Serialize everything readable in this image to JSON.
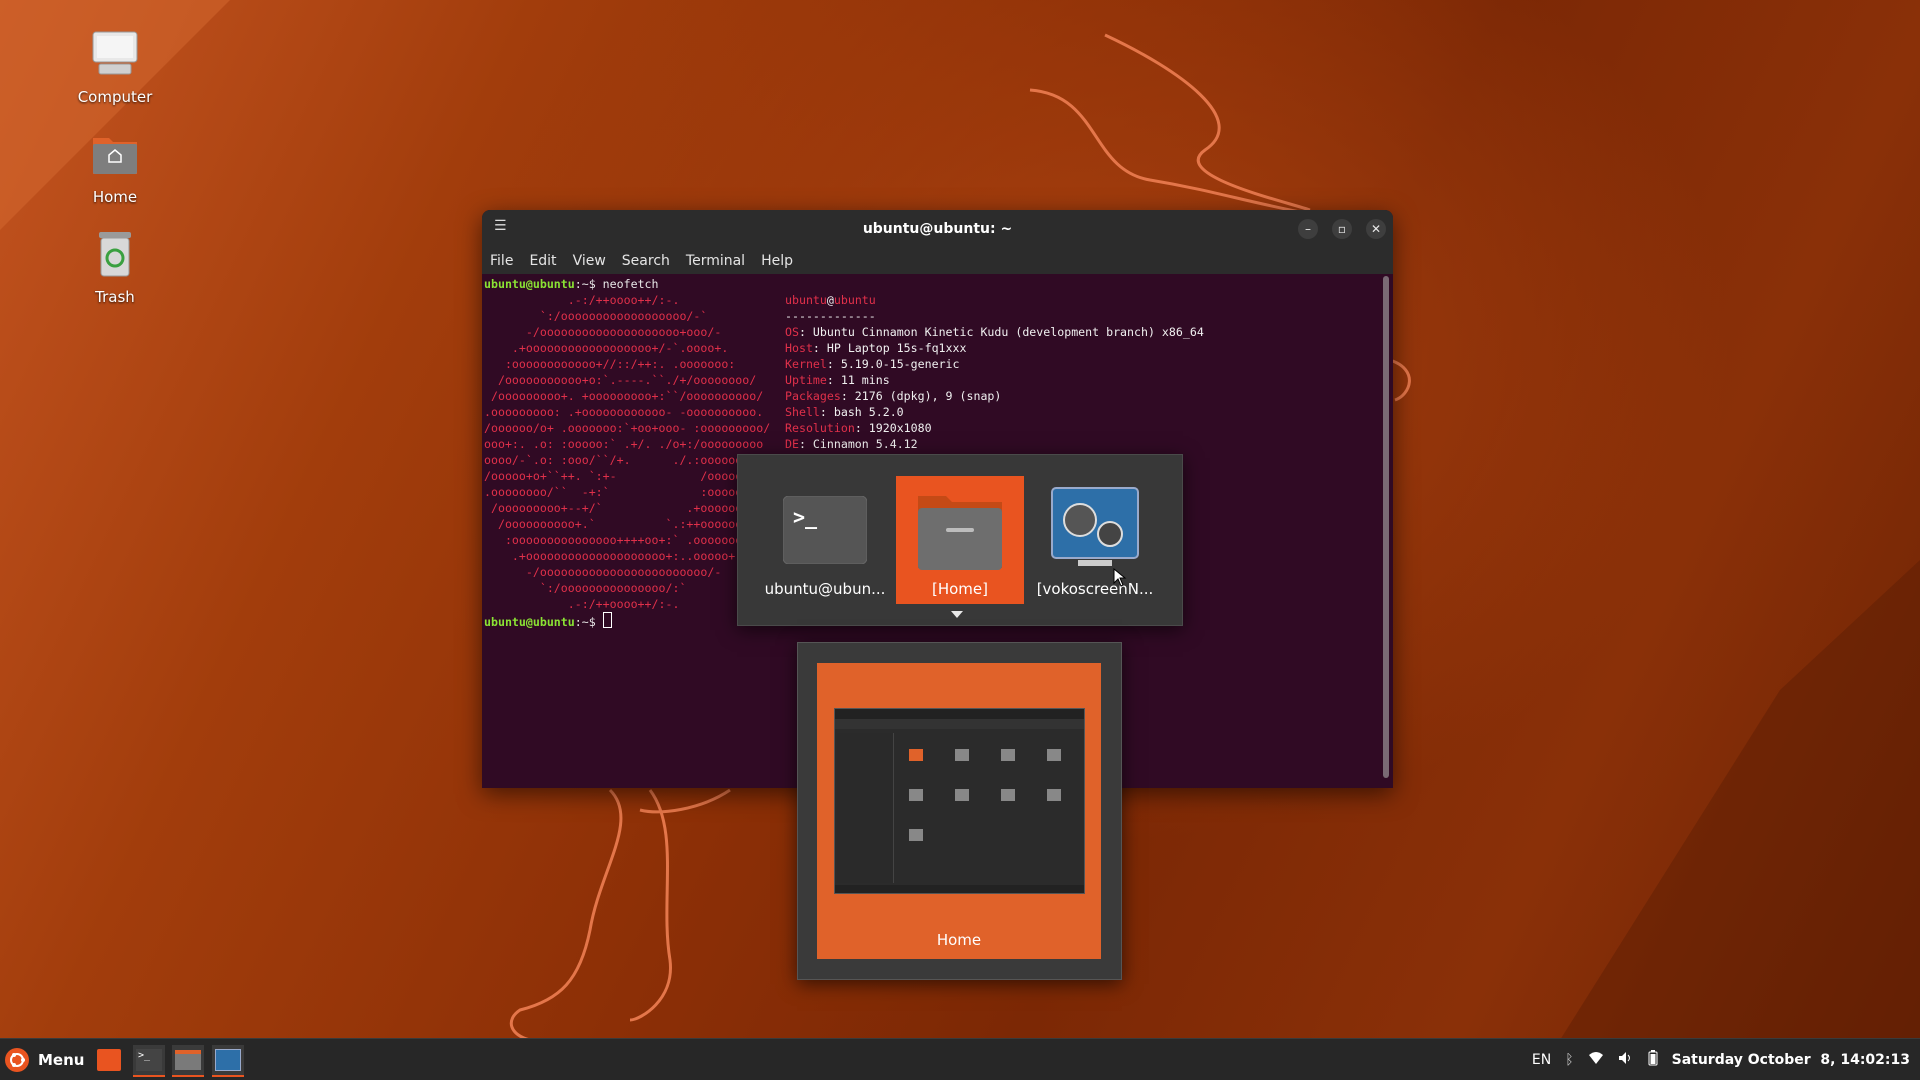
{
  "desktop": {
    "icons": [
      {
        "label": "Computer",
        "icon": "computer-icon"
      },
      {
        "label": "Home",
        "icon": "home-folder-icon"
      },
      {
        "label": "Trash",
        "icon": "trash-icon"
      }
    ]
  },
  "terminal": {
    "title": "ubuntu@ubuntu: ~",
    "menu": [
      "File",
      "Edit",
      "View",
      "Search",
      "Terminal",
      "Help"
    ],
    "prompt": "ubuntu@ubuntu",
    "prompt_suffix": ":~$ ",
    "command": "neofetch",
    "art_lines": [
      "            .-:/++oooo++/:-.",
      "        `:/oooooooooooooooooo/-`",
      "      -/oooooooooooooooooooo+ooo/-",
      "    .+oooooooooooooooooo+/-`.oooo+.",
      "   :oooooooooooo+//::/++:. .ooooooo:",
      "  /ooooooooooo+o:`.----.``./+/oooooooo/",
      " /ooooooooo+. +ooooooooo+:``/oooooooooo/",
      ".ooooooooo: .+oooooooooooo- -oooooooooo.",
      "/oooooo/o+ .ooooooo:`+oo+ooo- :ooooooooo/",
      "ooo+:. .o: :ooooo:` .+/. ./o+:/ooooooooo",
      "oooo/-`.o: :ooo/``/+.      ./.:ooooooo",
      "/ooooo+o+``++. `:+-            /ooooo",
      ".oooooooo/``  -+:`             :ooooo",
      " /ooooooooo+--+/`            .+ooooooo",
      "  /oooooooooo+.`          `.:++ooooooo",
      "   :ooooooooooooooo++++oo+:` .ooooooo",
      "    .+oooooooooooooooooooo+:..ooooo+.",
      "      -/oooooooooooooooooooooooo/-",
      "        `:/ooooooooooooooo/:`",
      "            .-:/++oooo++/:-."
    ],
    "info_header": {
      "user": "ubuntu",
      "at": "@",
      "host": "ubuntu",
      "separator": "-------------"
    },
    "info": [
      {
        "key": "OS",
        "value": ": Ubuntu Cinnamon Kinetic Kudu (development branch) x86_64"
      },
      {
        "key": "Host",
        "value": ": HP Laptop 15s-fq1xxx"
      },
      {
        "key": "Kernel",
        "value": ": 5.19.0-15-generic"
      },
      {
        "key": "Uptime",
        "value": ": 11 mins"
      },
      {
        "key": "Packages",
        "value": ": 2176 (dpkg), 9 (snap)"
      },
      {
        "key": "Shell",
        "value": ": bash 5.2.0"
      },
      {
        "key": "Resolution",
        "value": ": 1920x1080"
      },
      {
        "key": "DE",
        "value": ": Cinnamon 5.4.12"
      }
    ]
  },
  "switcher": {
    "items": [
      {
        "label": "ubuntu@ubun...",
        "icon": "terminal-icon",
        "selected": false
      },
      {
        "label": "[Home]",
        "icon": "folder-icon",
        "selected": true
      },
      {
        "label": "[vokoscreenN...",
        "icon": "vokoscreen-icon",
        "selected": false
      }
    ],
    "preview_label": "Home"
  },
  "taskbar": {
    "menu_label": "Menu",
    "tray": {
      "keyboard": "EN",
      "clock": "Saturday October  8, 14:02:13"
    }
  },
  "colors": {
    "accent": "#e95420",
    "terminal_bg": "#300a24",
    "prompt": "#8ae234",
    "neofetch_red": "#e0304a"
  }
}
